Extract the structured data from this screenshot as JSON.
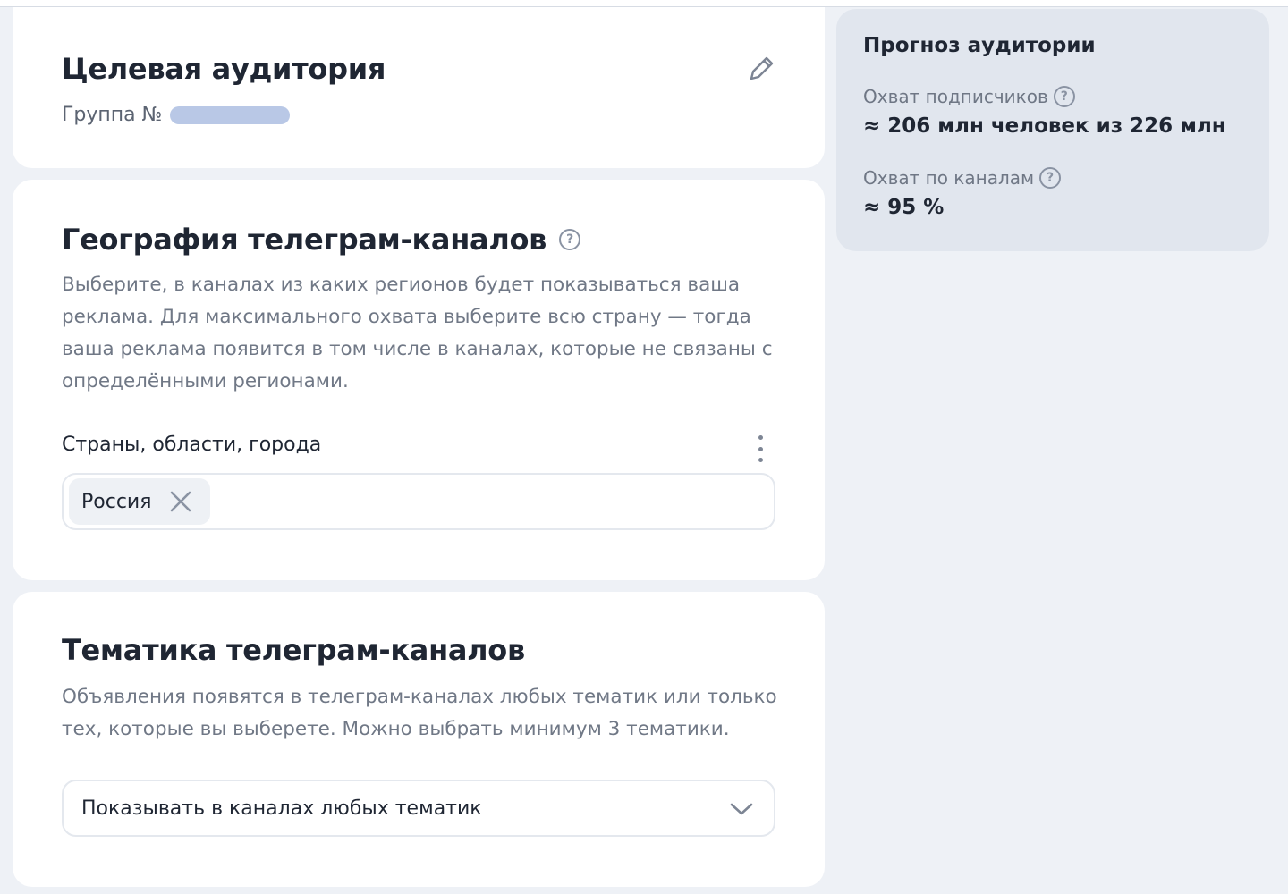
{
  "audience": {
    "title": "Целевая аудитория",
    "group_label": "Группа №"
  },
  "geo": {
    "title": "География телеграм-каналов",
    "description": "Выберите, в каналах из каких регионов будет показываться ваша реклама. Для максимального охвата выберите всю страну — тогда ваша реклама появится в том числе в каналах, которые не связаны с определёнными регионами.",
    "field_label": "Страны, области, города",
    "selected_regions": [
      "Россия"
    ]
  },
  "topic": {
    "title": "Тематика телеграм-каналов",
    "description": "Объявления появятся в телеграм-каналах любых тематик или только тех, которые вы выберете. Можно выбрать минимум 3 тематики.",
    "select_value": "Показывать в каналах любых тематик"
  },
  "forecast": {
    "title": "Прогноз аудитории",
    "subscribers_label": "Охват подписчиков",
    "subscribers_value": "≈ 206 млн человек из 226 млн",
    "channels_label": "Охват по каналам",
    "channels_value": "≈ 95 %"
  },
  "icons": {
    "help": "?",
    "edit": "pencil-icon",
    "more": "kebab-icon",
    "remove": "close-icon",
    "expand": "chevron-down-icon"
  },
  "colors": {
    "background": "#eef1f6",
    "card": "#ffffff",
    "sidebar": "#e1e6ee",
    "redacted": "#b9c8e6",
    "text": "#1f2633",
    "muted": "#707886"
  }
}
